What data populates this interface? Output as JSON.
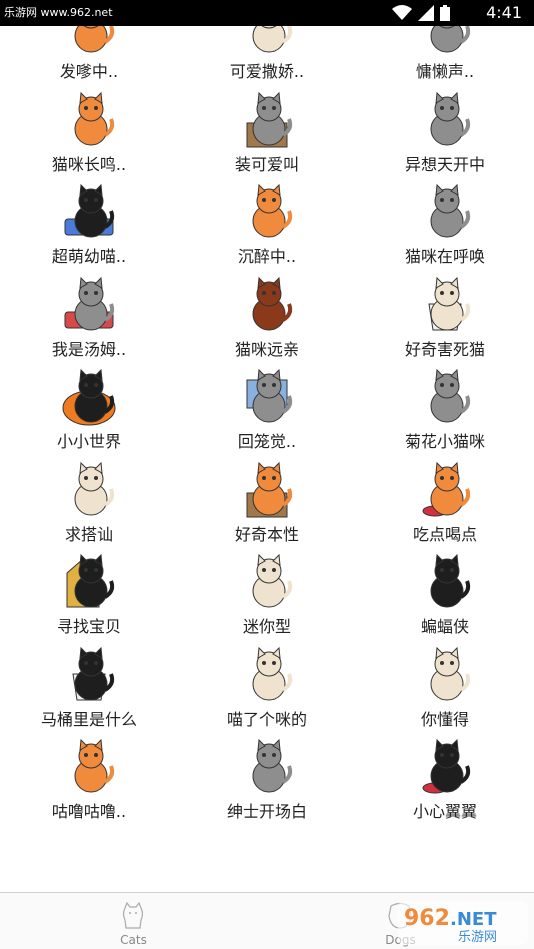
{
  "status_bar": {
    "site": "乐游网 www.962.net",
    "time": "4:41",
    "icons": [
      "wifi-icon",
      "signal-icon",
      "battery-icon"
    ]
  },
  "grid": {
    "items": [
      {
        "label": "发嗲中..",
        "icon": "orange-cat-icon"
      },
      {
        "label": "可爱撒娇..",
        "icon": "white-cat-icon"
      },
      {
        "label": "慵懒声..",
        "icon": "grey-cat-icon"
      },
      {
        "label": "猫咪长鸣..",
        "icon": "orange-cat-in-bubble-icon"
      },
      {
        "label": "装可爱叫",
        "icon": "cat-in-box-icon"
      },
      {
        "label": "异想天开中",
        "icon": "octopus-cat-icon"
      },
      {
        "label": "超萌幼喵..",
        "icon": "black-cat-in-tub-icon"
      },
      {
        "label": "沉醉中..",
        "icon": "orange-cat-standing-icon"
      },
      {
        "label": "猫咪在呼唤",
        "icon": "grey-cat-dancing-icon"
      },
      {
        "label": "我是汤姆..",
        "icon": "cat-in-basket-icon"
      },
      {
        "label": "猫咪远亲",
        "icon": "lion-icon"
      },
      {
        "label": "好奇害死猫",
        "icon": "cat-in-toilet-icon"
      },
      {
        "label": "小小世界",
        "icon": "pumpkin-cat-icon"
      },
      {
        "label": "回笼觉..",
        "icon": "laptop-cat-icon"
      },
      {
        "label": "菊花小猫咪",
        "icon": "grey-cat-back-icon"
      },
      {
        "label": "求搭讪",
        "icon": "cat-with-flower-icon"
      },
      {
        "label": "好奇本性",
        "icon": "cat-in-gift-box-icon"
      },
      {
        "label": "吃点喝点",
        "icon": "cat-with-bowl-icon"
      },
      {
        "label": "寻找宝贝",
        "icon": "cat-doghouse-icon"
      },
      {
        "label": "迷你型",
        "icon": "ghost-cat-icon"
      },
      {
        "label": "蝙蝠侠",
        "icon": "bat-cat-icon"
      },
      {
        "label": "马桶里是什么",
        "icon": "black-cat-toilet-icon"
      },
      {
        "label": "喵了个咪的",
        "icon": "mummy-cat-icon"
      },
      {
        "label": "你懂得",
        "icon": "cat-with-hearts-icon"
      },
      {
        "label": "咕噜咕噜..",
        "icon": "orange-cat-sitting-icon"
      },
      {
        "label": "绅士开场白",
        "icon": "grey-dog-cat-icon"
      },
      {
        "label": "小心翼翼",
        "icon": "cat-fishbowl-icon"
      }
    ]
  },
  "bottom_nav": {
    "tabs": [
      {
        "label": "Cats",
        "icon": "cat-tab-icon"
      },
      {
        "label": "Dogs",
        "icon": "dog-tab-icon"
      }
    ],
    "watermark": "962.NET 乐游网"
  },
  "colors": {
    "orange": "#f08a3c",
    "black": "#1e1e1e",
    "grey": "#8e8e8e",
    "cream": "#efe3cf",
    "status_bar": "#000000"
  }
}
